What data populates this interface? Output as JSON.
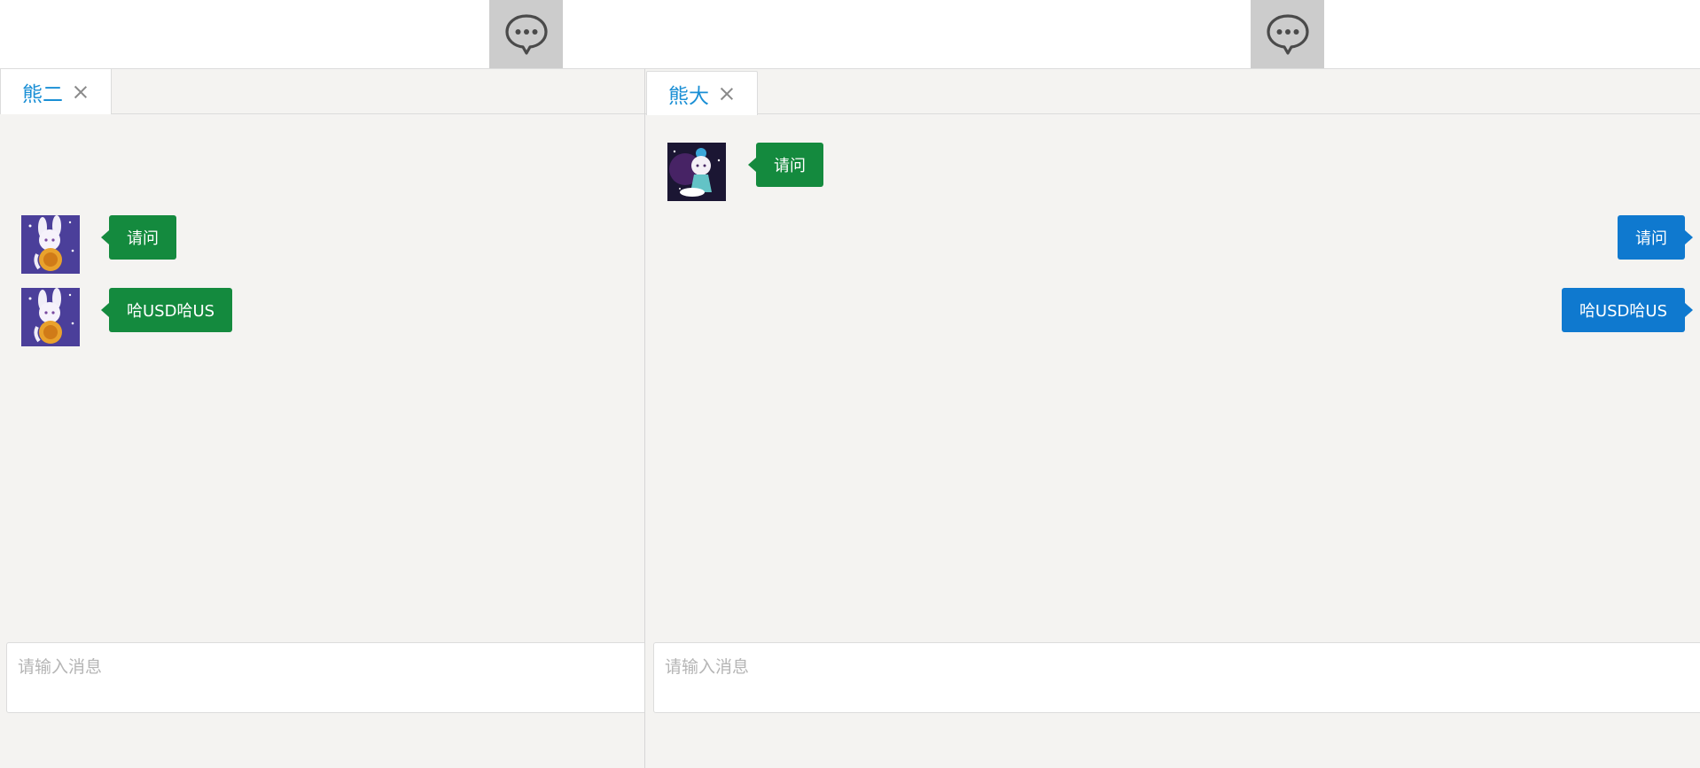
{
  "colors": {
    "tab_label": "#1a8fd5",
    "incoming_bubble": "#148a3e",
    "outgoing_bubble": "#0f79cf",
    "panel_bg": "#f4f3f1",
    "toggle_bg": "#cccccc"
  },
  "left_window": {
    "toggle_icon": "speech-bubble-ellipsis-icon",
    "tab": {
      "label": "熊二",
      "close_icon": "close-icon"
    },
    "messages": [
      {
        "direction": "incoming",
        "avatar": "bunny-avatar",
        "text": "请问"
      },
      {
        "direction": "incoming",
        "avatar": "bunny-avatar",
        "text": "哈USD哈US"
      }
    ],
    "input": {
      "placeholder": "请输入消息",
      "value": ""
    }
  },
  "right_window": {
    "toggle_icon": "speech-bubble-ellipsis-icon",
    "tab": {
      "label": "熊大",
      "close_icon": "close-icon"
    },
    "messages": [
      {
        "direction": "incoming",
        "avatar": "fairy-avatar",
        "text": "请问"
      },
      {
        "direction": "outgoing",
        "text": "请问"
      },
      {
        "direction": "outgoing",
        "text": "哈USD哈US"
      }
    ],
    "input": {
      "placeholder": "请输入消息",
      "value": ""
    }
  }
}
